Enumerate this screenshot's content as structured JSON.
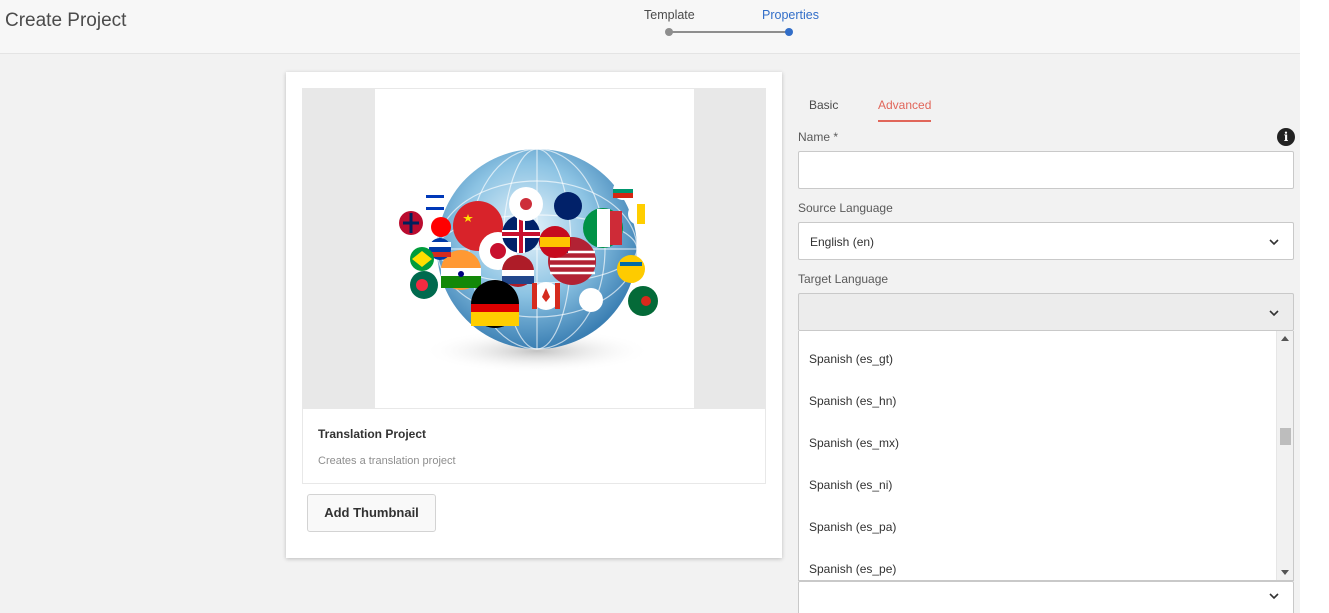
{
  "header": {
    "title": "Create Project",
    "wizard": {
      "steps": [
        {
          "label": "Template",
          "state": "complete"
        },
        {
          "label": "Properties",
          "state": "current"
        }
      ],
      "active_color": "#326ec8"
    }
  },
  "template_card": {
    "title": "Translation Project",
    "description": "Creates a translation project",
    "thumbnail_alt": "globe-with-speech-bubble-flags",
    "add_thumbnail_label": "Add Thumbnail"
  },
  "form": {
    "tabs": [
      {
        "label": "Basic",
        "active": false
      },
      {
        "label": "Advanced",
        "active": true
      }
    ],
    "accent_color": "#e1665a",
    "name": {
      "label": "Name *",
      "value": "",
      "placeholder": ""
    },
    "source_language": {
      "label": "Source Language",
      "value": "English (en)"
    },
    "target_language": {
      "label": "Target Language",
      "value": "",
      "visible_options": [
        "Spanish (es_gt)",
        "Spanish (es_hn)",
        "Spanish (es_mx)",
        "Spanish (es_ni)",
        "Spanish (es_pa)",
        "Spanish (es_pe)"
      ]
    }
  }
}
